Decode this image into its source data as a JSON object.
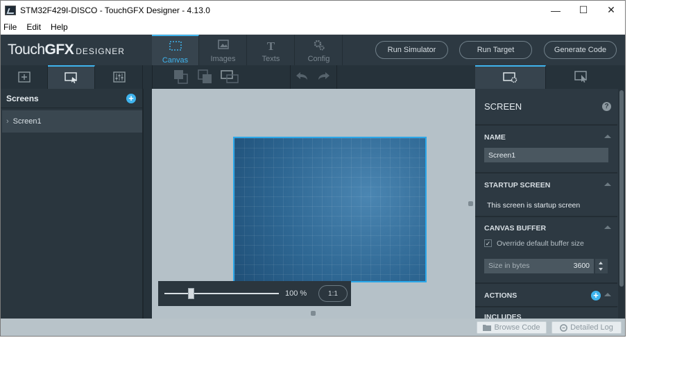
{
  "window": {
    "title": "STM32F429I-DISCO - TouchGFX Designer - 4.13.0",
    "minimize_glyph": "—",
    "maximize_glyph": "☐",
    "close_glyph": "✕"
  },
  "menu": [
    "File",
    "Edit",
    "Help"
  ],
  "logo": {
    "touch": "Touch",
    "gfx": "GFX",
    "designer": "DESIGNER"
  },
  "main_tabs": [
    {
      "label": "Canvas",
      "icon": "canvas-icon",
      "active": true
    },
    {
      "label": "Images",
      "icon": "images-icon",
      "active": false
    },
    {
      "label": "Texts",
      "icon": "texts-icon",
      "active": false
    },
    {
      "label": "Config",
      "icon": "config-icon",
      "active": false
    }
  ],
  "actions": {
    "run_simulator": "Run Simulator",
    "run_target": "Run Target",
    "generate_code": "Generate Code"
  },
  "left_panel": {
    "header": "Screens",
    "screens": [
      {
        "name": "Screen1"
      }
    ]
  },
  "canvas": {
    "zoom_percent_label": "100 %",
    "zoom_level": 1.0,
    "one_to_one_label": "1:1"
  },
  "properties": {
    "title": "SCREEN",
    "help_glyph": "?",
    "name_header": "NAME",
    "name_value": "Screen1",
    "startup_header": "STARTUP SCREEN",
    "startup_text": "This screen is startup screen",
    "canvas_buffer_header": "CANVAS BUFFER",
    "override_label": "Override default buffer size",
    "override_checked": true,
    "size_label": "Size in bytes",
    "size_value": "3600",
    "actions_header": "ACTIONS",
    "includes_header": "INCLUDES"
  },
  "bottom": {
    "browse_code": "Browse Code",
    "detailed_log": "Detailed Log"
  },
  "colors": {
    "accent": "#3fb4ee",
    "toolbar_bg": "#2d3942",
    "canvas_bg": "#b5c1c8",
    "screen_fill": "#2f6e9c"
  }
}
